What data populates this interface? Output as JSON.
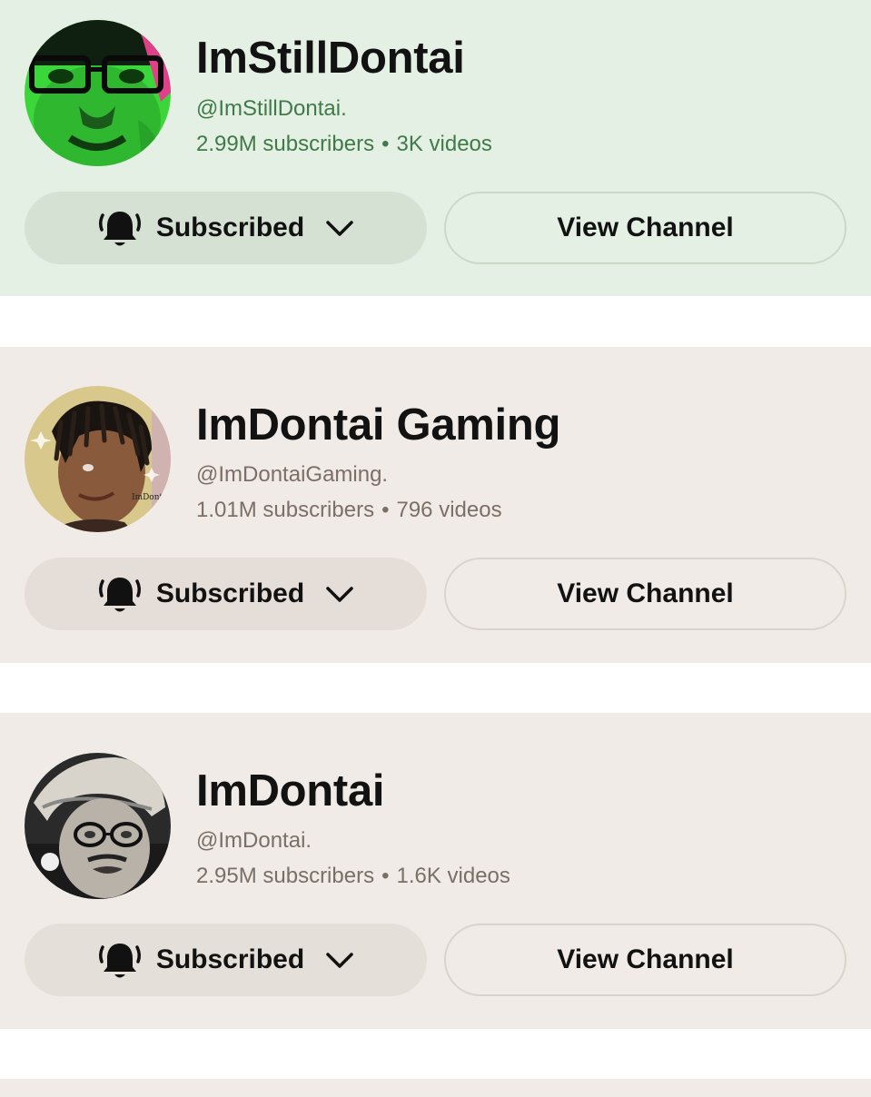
{
  "channels": [
    {
      "name": "ImStillDontai",
      "handle": "@ImStillDontai.",
      "subscribers": "2.99M subscribers",
      "separator": "•",
      "videos": "3K videos",
      "subscribe_label": "Subscribed",
      "view_label": "View Channel",
      "bg_color": "#e5f0e4",
      "accent_color": "#3f7a48"
    },
    {
      "name": "ImDontai Gaming",
      "handle": "@ImDontaiGaming.",
      "subscribers": "1.01M subscribers",
      "separator": "•",
      "videos": "796 videos",
      "subscribe_label": "Subscribed",
      "view_label": "View Channel",
      "bg_color": "#f1ebe7",
      "accent_color": "#7d6e66"
    },
    {
      "name": "ImDontai",
      "handle": "@ImDontai.",
      "subscribers": "2.95M subscribers",
      "separator": "•",
      "videos": "1.6K videos",
      "subscribe_label": "Subscribed",
      "view_label": "View Channel",
      "bg_color": "#f0ebe6",
      "accent_color": "#7a6f66"
    }
  ],
  "icons": {
    "bell": "bell-ringing-icon",
    "chevron": "chevron-down-icon"
  }
}
